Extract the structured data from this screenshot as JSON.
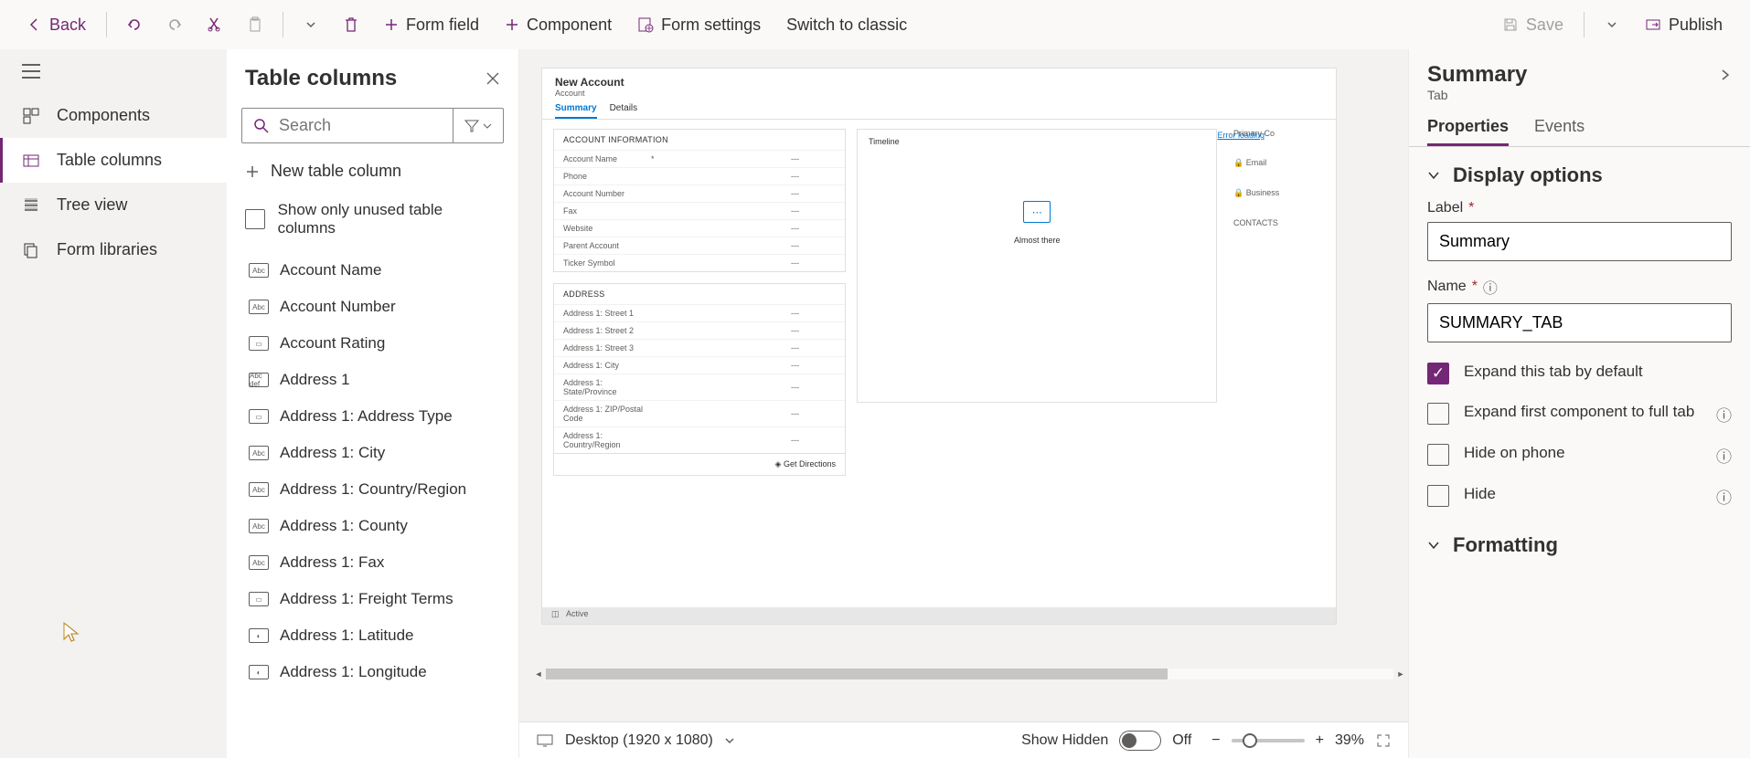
{
  "toolbar": {
    "back": "Back",
    "form_field": "Form field",
    "component": "Component",
    "form_settings": "Form settings",
    "switch_classic": "Switch to classic",
    "save": "Save",
    "publish": "Publish"
  },
  "leftrail": {
    "components": "Components",
    "table_columns": "Table columns",
    "tree_view": "Tree view",
    "form_libraries": "Form libraries"
  },
  "colpanel": {
    "title": "Table columns",
    "search_placeholder": "Search",
    "new_col": "New table column",
    "unused_only": "Show only unused table columns",
    "items": [
      "Account Name",
      "Account Number",
      "Account Rating",
      "Address 1",
      "Address 1: Address Type",
      "Address 1: City",
      "Address 1: Country/Region",
      "Address 1: County",
      "Address 1: Fax",
      "Address 1: Freight Terms",
      "Address 1: Latitude",
      "Address 1: Longitude"
    ]
  },
  "canvas": {
    "title": "New Account",
    "subtitle": "Account",
    "tabs": [
      "Summary",
      "Details"
    ],
    "section1": "ACCOUNT INFORMATION",
    "fields1": [
      {
        "l": "Account Name",
        "req": "*",
        "v": "---"
      },
      {
        "l": "Phone",
        "req": "",
        "v": "---"
      },
      {
        "l": "Account Number",
        "req": "",
        "v": "---"
      },
      {
        "l": "Fax",
        "req": "",
        "v": "---"
      },
      {
        "l": "Website",
        "req": "",
        "v": "---"
      },
      {
        "l": "Parent Account",
        "req": "",
        "v": "---"
      },
      {
        "l": "Ticker Symbol",
        "req": "",
        "v": "---"
      }
    ],
    "section2": "ADDRESS",
    "fields2": [
      {
        "l": "Address 1: Street 1",
        "v": "---"
      },
      {
        "l": "Address 1: Street 2",
        "v": "---"
      },
      {
        "l": "Address 1: Street 3",
        "v": "---"
      },
      {
        "l": "Address 1: City",
        "v": "---"
      },
      {
        "l": "Address 1: State/Province",
        "v": "---"
      },
      {
        "l": "Address 1: ZIP/Postal Code",
        "v": "---"
      },
      {
        "l": "Address 1: Country/Region",
        "v": "---"
      }
    ],
    "getdir": "Get Directions",
    "timeline": "Timeline",
    "almost": "Almost there",
    "errload": "Error loading",
    "right_items": [
      "Primary Co",
      "Email",
      "Business",
      "CONTACTS"
    ],
    "status": "Active"
  },
  "bottombar": {
    "device": "Desktop (1920 x 1080)",
    "show_hidden": "Show Hidden",
    "toggle_state": "Off",
    "zoom": "39%"
  },
  "rightpanel": {
    "title": "Summary",
    "subtitle": "Tab",
    "tab_properties": "Properties",
    "tab_events": "Events",
    "display_options": "Display options",
    "label_lab": "Label",
    "label_val": "Summary",
    "name_lab": "Name",
    "name_val": "SUMMARY_TAB",
    "expand_default": "Expand this tab by default",
    "expand_first": "Expand first component to full tab",
    "hide_phone": "Hide on phone",
    "hide": "Hide",
    "formatting": "Formatting"
  }
}
